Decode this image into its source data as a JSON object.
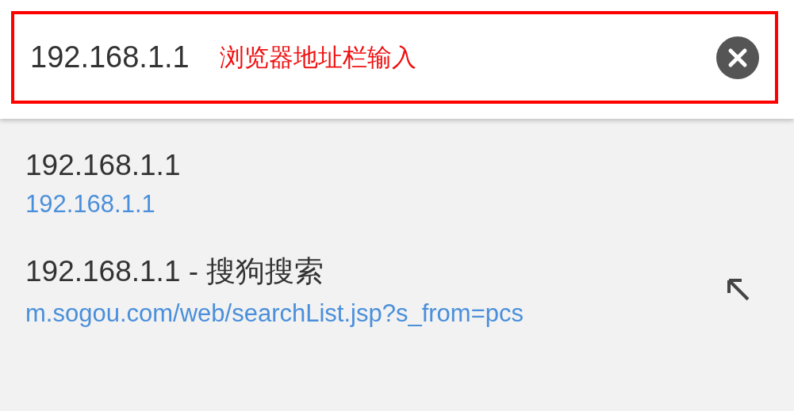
{
  "address_bar": {
    "value": "192.168.1.1",
    "annotation": "浏览器地址栏输入"
  },
  "suggestions": [
    {
      "title": "192.168.1.1",
      "url": "192.168.1.1",
      "fill_arrow": false
    },
    {
      "title": "192.168.1.1 - 搜狗搜索",
      "url": "m.sogou.com/web/searchList.jsp?s_from=pcs",
      "fill_arrow": true
    }
  ]
}
